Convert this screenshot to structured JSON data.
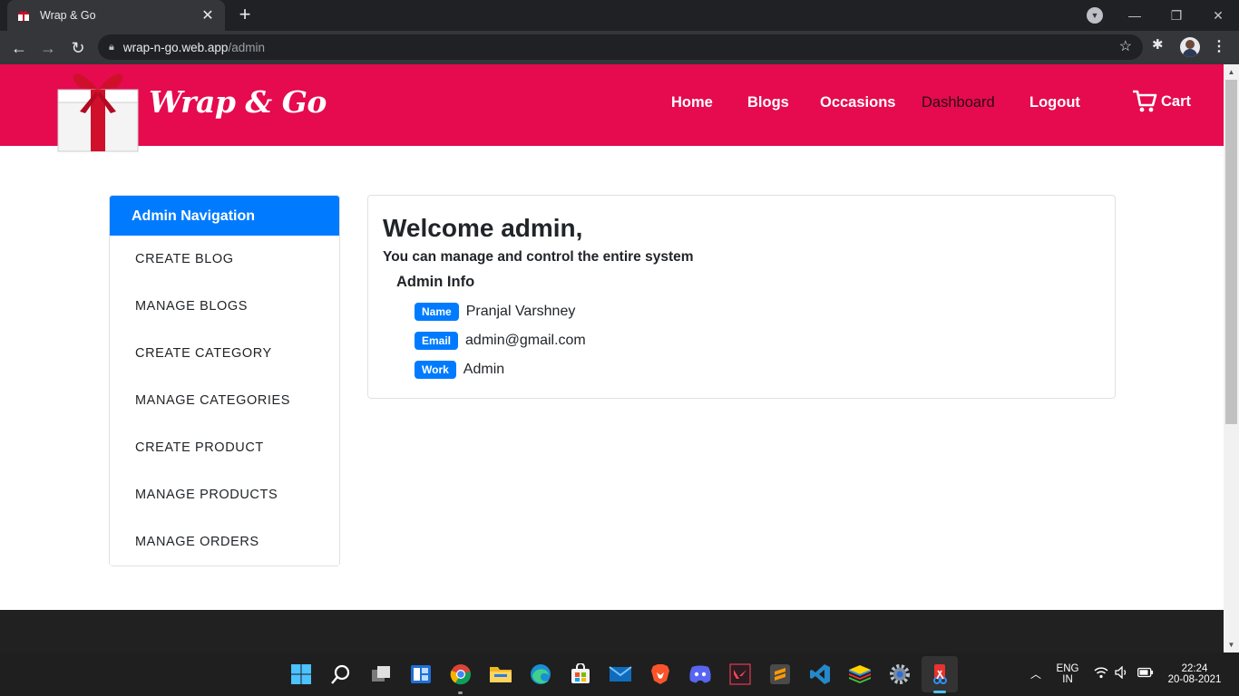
{
  "browser": {
    "tab_title": "Wrap & Go",
    "url_host": "wrap-n-go.web.app",
    "url_path": "/admin"
  },
  "site": {
    "brand": "Wrap & Go",
    "nav": [
      "Home",
      "Blogs",
      "Occasions",
      "Dashboard",
      "Logout"
    ],
    "active_nav": "Dashboard",
    "cart_label": "Cart",
    "colors": {
      "header": "#e60a4f",
      "primary": "#007bff",
      "footer": "#212121"
    }
  },
  "sidebar": {
    "title": "Admin Navigation",
    "items": [
      "CREATE BLOG",
      "MANAGE BLOGS",
      "CREATE CATEGORY",
      "MANAGE CATEGORIES",
      "CREATE PRODUCT",
      "MANAGE PRODUCTS",
      "MANAGE ORDERS"
    ]
  },
  "main": {
    "welcome": "Welcome admin,",
    "subtitle": "You can manage and control the entire system",
    "info_title": "Admin Info",
    "info": [
      {
        "label": "Name",
        "value": "Pranjal Varshney"
      },
      {
        "label": "Email",
        "value": "admin@gmail.com"
      },
      {
        "label": "Work",
        "value": "Admin"
      }
    ]
  },
  "taskbar": {
    "lang_top": "ENG",
    "lang_bottom": "IN",
    "time": "22:24",
    "date": "20-08-2021",
    "apps": [
      "windows-start-icon",
      "search-icon",
      "task-view-icon",
      "widgets-icon",
      "chrome-icon",
      "file-explorer-icon",
      "edge-icon",
      "store-icon",
      "mail-icon",
      "brave-icon",
      "discord-icon",
      "valorant-icon",
      "sublime-text-icon",
      "vscode-icon",
      "bluestacks-icon",
      "settings-icon",
      "snipping-tool-icon"
    ]
  }
}
